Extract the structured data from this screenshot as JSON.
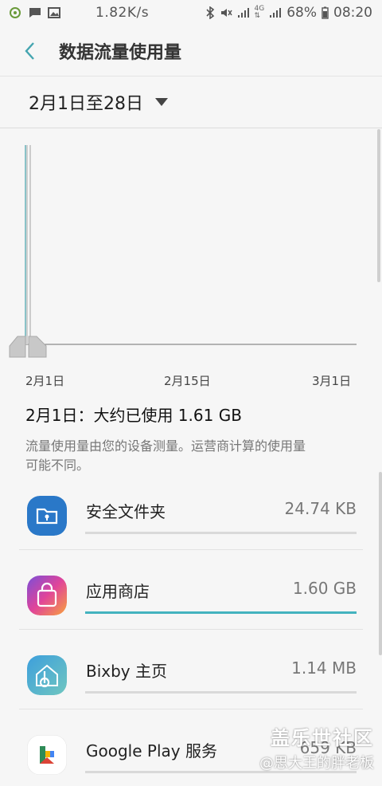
{
  "status_bar": {
    "speed": "1.82K/s",
    "net_small_top": "4G",
    "net_small_bottom": "4G",
    "battery": "68%",
    "time": "08:20",
    "icons": [
      "notification-icon",
      "message-icon",
      "image-icon",
      "bluetooth-icon",
      "mute-icon",
      "signal-icon",
      "signal-icon",
      "battery-icon"
    ]
  },
  "app_bar": {
    "title": "数据流量使用量",
    "back_icon": "chevron-left-icon"
  },
  "date_selector": {
    "label": "2月1日至28日",
    "icon": "dropdown-triangle-icon"
  },
  "chart_data": {
    "type": "line",
    "x_tick_labels": [
      "2月1日",
      "2月15日",
      "3月1日"
    ],
    "range_handles": [
      "2月1日",
      "2月1日"
    ],
    "ylim": [
      0,
      1
    ],
    "usage_spike_day": "2月1日"
  },
  "summary": "2月1日：大约已使用 1.61 GB",
  "note": "流量使用量由您的设备测量。运营商计算的使用量可能不同。",
  "apps": [
    {
      "name": "安全文件夹",
      "value": "24.74 KB",
      "fraction": 0.0,
      "icon": "secure-folder-icon"
    },
    {
      "name": "应用商店",
      "value": "1.60 GB",
      "fraction": 1.0,
      "icon": "app-store-icon"
    },
    {
      "name": "Bixby 主页",
      "value": "1.14 MB",
      "fraction": 0.0,
      "icon": "bixby-home-icon"
    },
    {
      "name": "Google Play 服务",
      "value": "659 KB",
      "fraction": 0.0,
      "icon": "google-play-services-icon"
    }
  ],
  "watermark": {
    "line1": "盖乐世社区",
    "line2": "@思大王的胖老板"
  },
  "colors": {
    "accent": "#44b3bf",
    "background": "#f6f6f6"
  }
}
